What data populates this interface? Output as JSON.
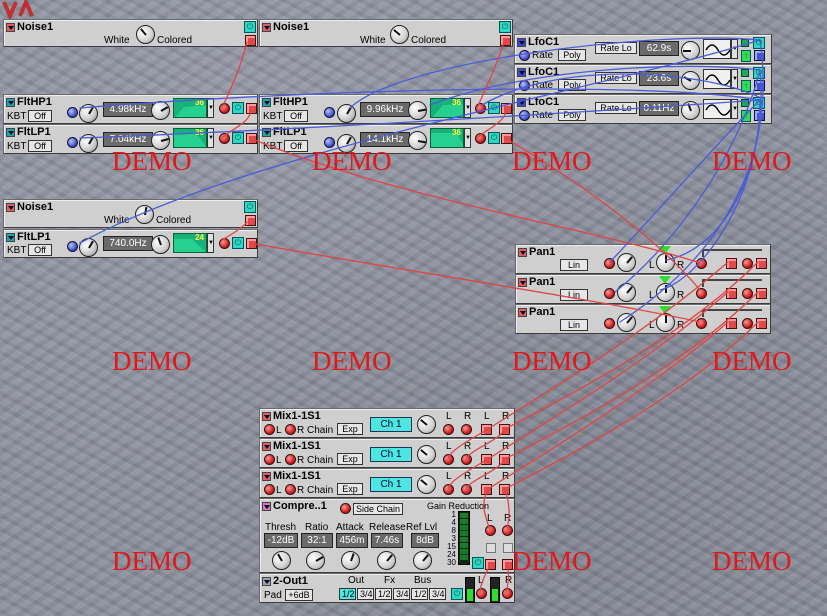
{
  "noise_modules": [
    {
      "title": "Noise1",
      "left_label": "White",
      "right_label": "Colored"
    },
    {
      "title": "Noise1",
      "left_label": "White",
      "right_label": "Colored"
    },
    {
      "title": "Noise1",
      "left_label": "White",
      "right_label": "Colored"
    }
  ],
  "filters": [
    {
      "title": "FltHP1",
      "kbt_label": "KBT",
      "kbt_value": "Off",
      "freq": "4.98kHz",
      "slope": "36"
    },
    {
      "title": "FltLP1",
      "kbt_label": "KBT",
      "kbt_value": "Off",
      "freq": "7.04kHz",
      "slope": "36"
    },
    {
      "title": "FltHP1",
      "kbt_label": "KBT",
      "kbt_value": "Off",
      "freq": "9.96kHz",
      "slope": "36"
    },
    {
      "title": "FltLP1",
      "kbt_label": "KBT",
      "kbt_value": "Off",
      "freq": "14.1kHz",
      "slope": "36"
    },
    {
      "title": "FltLP1",
      "kbt_label": "KBT",
      "kbt_value": "Off",
      "freq": "740.0Hz",
      "slope": "24"
    }
  ],
  "lfos": [
    {
      "title": "LfoC1",
      "rate_label": "Rate",
      "mode": "Poly",
      "range": "Rate Lo",
      "value": "62.9s"
    },
    {
      "title": "LfoC1",
      "rate_label": "Rate",
      "mode": "Poly",
      "range": "Rate Lo",
      "value": "23.6s"
    },
    {
      "title": "LfoC1",
      "rate_label": "Rate",
      "mode": "Poly",
      "range": "Rate Lo",
      "value": "0.11Hz"
    }
  ],
  "pans": [
    {
      "title": "Pan1",
      "mode": "Lin",
      "l": "L",
      "r": "R"
    },
    {
      "title": "Pan1",
      "mode": "Lin",
      "l": "L",
      "r": "R"
    },
    {
      "title": "Pan1",
      "mode": "Lin",
      "l": "L",
      "r": "R"
    }
  ],
  "mixers": [
    {
      "title": "Mix1-1S1",
      "l": "L",
      "r_chain": "R Chain",
      "exp": "Exp",
      "channel": "Ch 1",
      "out_l": "L",
      "out_r": "R",
      "chain_l": "L",
      "chain_r": "R"
    },
    {
      "title": "Mix1-1S1",
      "l": "L",
      "r_chain": "R Chain",
      "exp": "Exp",
      "channel": "Ch 1",
      "out_l": "L",
      "out_r": "R",
      "chain_l": "L",
      "chain_r": "R"
    },
    {
      "title": "Mix1-1S1",
      "l": "L",
      "r_chain": "R Chain",
      "exp": "Exp",
      "channel": "Ch 1",
      "out_l": "L",
      "out_r": "R",
      "chain_l": "L",
      "chain_r": "R"
    }
  ],
  "compressor": {
    "title": "Compre..1",
    "side_chain": "Side Chain",
    "gain_reduction": "Gain Reduction",
    "params": [
      {
        "label": "Thresh",
        "value": "-12dB"
      },
      {
        "label": "Ratio",
        "value": "32:1"
      },
      {
        "label": "Attack",
        "value": "456m"
      },
      {
        "label": "Release",
        "value": "7.46s"
      },
      {
        "label": "Ref Lvl",
        "value": "8dB"
      }
    ],
    "scale": [
      "1",
      "4",
      "8",
      "3",
      "15",
      "24",
      "30"
    ],
    "l": "L",
    "r": "R"
  },
  "output": {
    "title": "2-Out1",
    "pad_label": "Pad",
    "pad_value": "+6dB",
    "groups": [
      {
        "label": "Out",
        "options": [
          "1/2",
          "3/4"
        ]
      },
      {
        "label": "Fx",
        "options": [
          "1/2",
          "3/4"
        ]
      },
      {
        "label": "Bus",
        "options": [
          "1/2",
          "3/4"
        ]
      }
    ],
    "l": "L",
    "r": "R",
    "level_fraction": 0.55
  },
  "watermark": "DEMO",
  "colors": {
    "panel": "#cfcfcf",
    "background": "#8a8e9c",
    "cable_red": "#e04545",
    "cable_blue": "#4a5cd8",
    "demo_red": "#e01818",
    "display_cyan": "#4de6e0"
  }
}
